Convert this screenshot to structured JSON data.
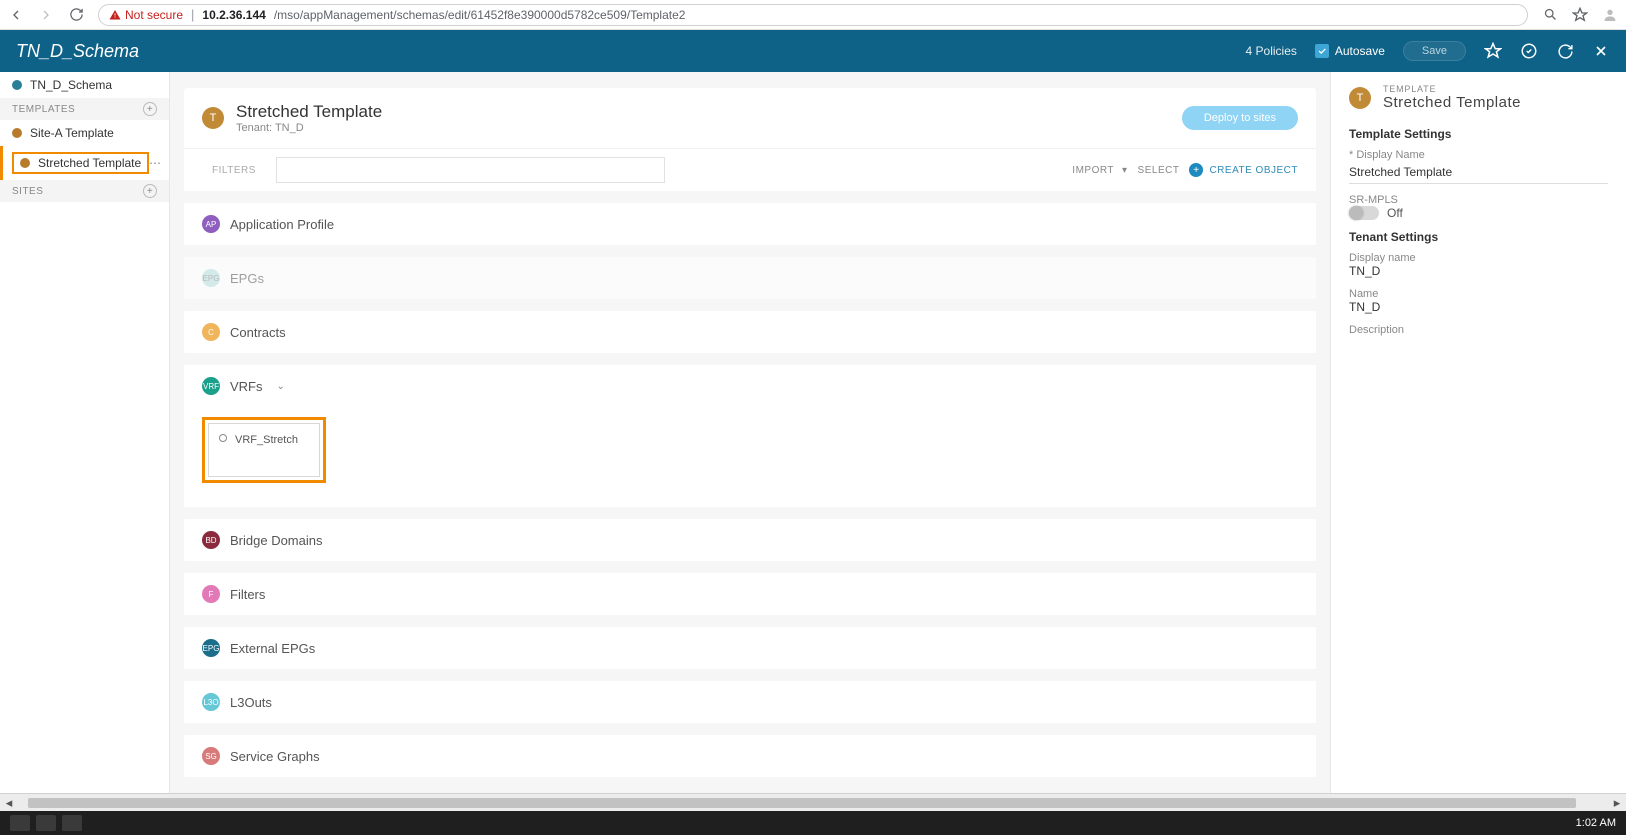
{
  "browser": {
    "not_secure": "Not secure",
    "host": "10.2.36.144",
    "path": "/mso/appManagement/schemas/edit/61452f8e390000d5782ce509/Template2"
  },
  "header": {
    "title": "TN_D_Schema",
    "policies": "4 Policies",
    "autosave": "Autosave",
    "save": "Save"
  },
  "leftnav": {
    "schema": "TN_D_Schema",
    "section_templates": "TEMPLATES",
    "section_sites": "SITES",
    "templates": [
      {
        "label": "Site-A Template"
      },
      {
        "label": "Stretched Template"
      }
    ]
  },
  "template_head": {
    "badge": "T",
    "title": "Stretched Template",
    "tenant_line": "Tenant: TN_D",
    "deploy": "Deploy to sites"
  },
  "toolbar": {
    "filters": "FILTERS",
    "import": "IMPORT",
    "select": "SELECT",
    "create": "CREATE OBJECT"
  },
  "sections": {
    "app_profile": "Application Profile",
    "epgs": "EPGs",
    "contracts": "Contracts",
    "vrfs": "VRFs",
    "bridge_domains": "Bridge Domains",
    "filters": "Filters",
    "external_epgs": "External EPGs",
    "l3outs": "L3Outs",
    "service_graphs": "Service Graphs"
  },
  "vrf_card": {
    "name": "VRF_Stretch"
  },
  "right_panel": {
    "eyebrow": "TEMPLATE",
    "title": "Stretched Template",
    "template_settings": "Template Settings",
    "display_name_label": "* Display Name",
    "display_name_value": "Stretched Template",
    "srmpls_label": "SR-MPLS",
    "srmpls_value": "Off",
    "tenant_settings": "Tenant Settings",
    "tenant_display_name_label": "Display name",
    "tenant_display_name_value": "TN_D",
    "tenant_name_label": "Name",
    "tenant_name_value": "TN_D",
    "description_label": "Description"
  },
  "taskbar": {
    "time": "1:02 AM"
  }
}
